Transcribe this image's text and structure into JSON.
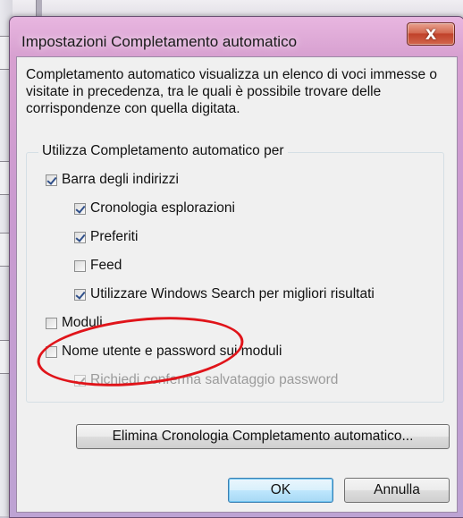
{
  "window": {
    "title": "Impostazioni Completamento automatico",
    "close_glyph": "X"
  },
  "description": "Completamento automatico visualizza un elenco di voci immesse o visitate in precedenza, tra le quali è possibile trovare delle corrispondenze con quella digitata.",
  "group": {
    "label": "Utilizza Completamento automatico per"
  },
  "options": [
    {
      "label": "Barra degli indirizzi",
      "checked": true,
      "enabled": true
    },
    {
      "label": "Cronologia esplorazioni",
      "checked": true,
      "enabled": true
    },
    {
      "label": "Preferiti",
      "checked": true,
      "enabled": true
    },
    {
      "label": "Feed",
      "checked": false,
      "enabled": true
    },
    {
      "label": "Utilizzare Windows Search per migliori risultati",
      "checked": true,
      "enabled": true
    },
    {
      "label": "Moduli",
      "checked": false,
      "enabled": true
    },
    {
      "label": "Nome utente e password sui moduli",
      "checked": false,
      "enabled": true
    },
    {
      "label": "Richiedi conferma salvataggio password",
      "checked": true,
      "enabled": false
    }
  ],
  "buttons": {
    "delete_history": "Elimina Cronologia Completamento automatico...",
    "ok": "OK",
    "cancel": "Annulla"
  },
  "colors": {
    "highlight_ellipse": "#e0141a",
    "close_button": "#c0412a"
  }
}
